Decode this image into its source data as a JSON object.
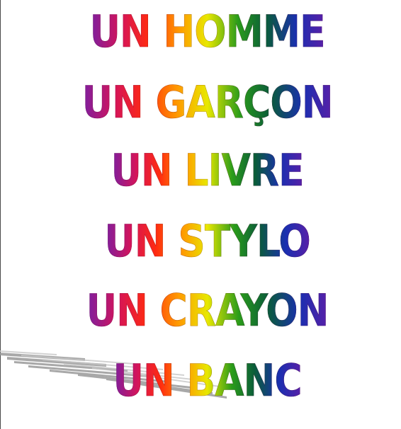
{
  "words": [
    "UN HOMME",
    "UN GARÇON",
    "UN LIVRE",
    "UN STYLO",
    "UN CRAYON",
    "UN BANC"
  ],
  "colors": {
    "gradient": [
      "#7a1fa2",
      "#d4145a",
      "#ff2a10",
      "#ff9a00",
      "#e8e800",
      "#2a9c1a",
      "#0a5c3a",
      "#1a2fb0",
      "#5a1fa8"
    ],
    "shadow": "#9a9a9a",
    "background": "#ffffff"
  }
}
